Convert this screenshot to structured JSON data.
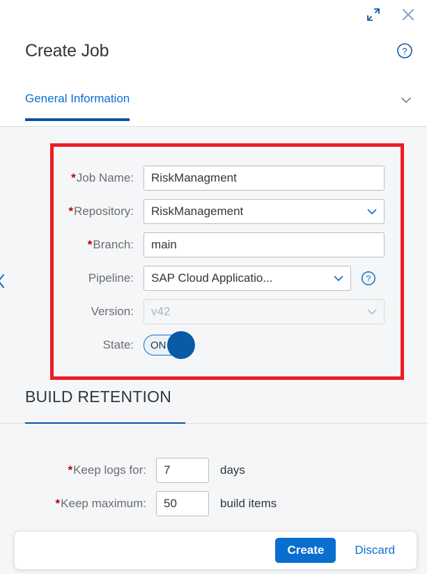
{
  "window": {
    "expand_icon": "expand-icon",
    "close_icon": "close-icon"
  },
  "header": {
    "title": "Create Job",
    "help_icon": "help-circle-icon"
  },
  "tabs": [
    {
      "label": "General Information",
      "selected": true
    }
  ],
  "tab_collapse_icon": "chevron-down-icon",
  "left_nav_icon": "chevron-left-icon",
  "highlight": {
    "color": "#ed1c24"
  },
  "general_information": {
    "fields": [
      {
        "label": "Job Name:",
        "required": true,
        "type": "input",
        "value": "RiskManagment",
        "disabled": false,
        "help": false
      },
      {
        "label": "Repository:",
        "required": true,
        "type": "select",
        "value": "RiskManagement",
        "disabled": false,
        "help": false
      },
      {
        "label": "Branch:",
        "required": true,
        "type": "input",
        "value": "main",
        "disabled": false,
        "help": false
      },
      {
        "label": "Pipeline:",
        "required": false,
        "type": "select",
        "value": "SAP Cloud Applicatio...",
        "disabled": false,
        "help": true
      },
      {
        "label": "Version:",
        "required": false,
        "type": "select",
        "value": "v42",
        "disabled": true,
        "help": false
      },
      {
        "label": "State:",
        "required": false,
        "type": "switch",
        "value": "ON",
        "disabled": false,
        "help": false
      }
    ]
  },
  "build_retention": {
    "heading": "BUILD RETENTION",
    "fields": [
      {
        "label": "Keep logs for:",
        "required": true,
        "value": "7",
        "unit": "days"
      },
      {
        "label": "Keep maximum:",
        "required": true,
        "value": "50",
        "unit": "build items"
      }
    ]
  },
  "footer": {
    "create_label": "Create",
    "discard_label": "Discard"
  },
  "colors": {
    "accent": "#0a6ed1",
    "accent_dark": "#0854a0",
    "required": "#bb0000",
    "highlight": "#ed1c24",
    "label": "#6a6d70",
    "text": "#32363a",
    "page_bg": "#f5f6f7"
  }
}
